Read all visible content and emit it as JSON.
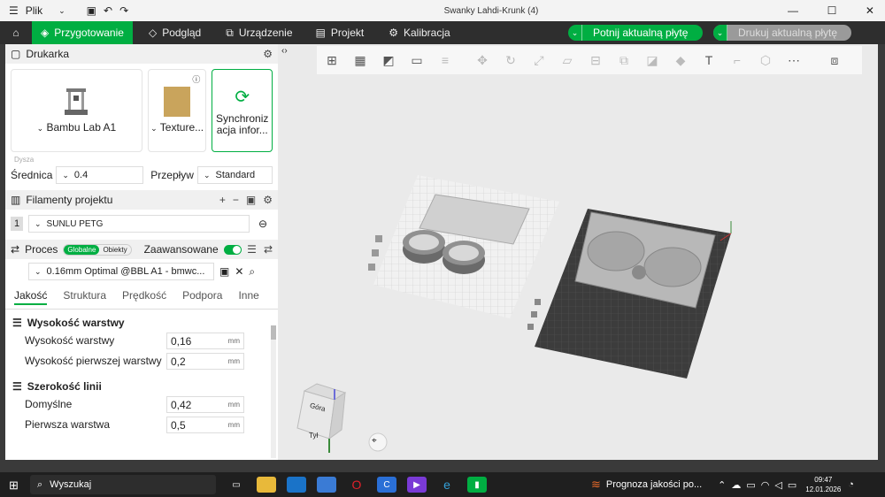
{
  "window": {
    "menu_label": "Plik",
    "title": "Swanky Lahdi-Krunk (4)"
  },
  "tabs": [
    {
      "label": "Przygotowanie"
    },
    {
      "label": "Podgląd"
    },
    {
      "label": "Urządzenie"
    },
    {
      "label": "Projekt"
    },
    {
      "label": "Kalibracja"
    }
  ],
  "actions": {
    "slice": "Potnij aktualną płytę",
    "print": "Drukuj aktualną płytę"
  },
  "printer": {
    "header": "Drukarka",
    "model": "Bambu Lab A1",
    "plate": "Texture...",
    "sync_label_1": "Synchroniz",
    "sync_label_2": "acja infor...",
    "nozzle_section": "Dysza",
    "diameter_label": "Średnica",
    "diameter_value": "0.4",
    "flow_label": "Przepływ",
    "flow_value": "Standard"
  },
  "filaments": {
    "header": "Filamenty projektu",
    "items": [
      {
        "index": "1",
        "name": "SUNLU PETG",
        "color": "#dcdcdc"
      }
    ]
  },
  "process": {
    "header": "Proces",
    "mode_global": "Globalne",
    "mode_objects": "Obiekty",
    "advanced_label": "Zaawansowane",
    "profile": "0.16mm Optimal @BBL A1 - bmwc...",
    "tabs": [
      "Jakość",
      "Struktura",
      "Prędkość",
      "Podpora",
      "Inne"
    ],
    "groups": [
      {
        "title": "Wysokość warstwy",
        "params": [
          {
            "name": "Wysokość warstwy",
            "value": "0,16",
            "unit": "mm"
          },
          {
            "name": "Wysokość pierwszej warstwy",
            "value": "0,2",
            "unit": "mm"
          }
        ]
      },
      {
        "title": "Szerokość linii",
        "params": [
          {
            "name": "Domyślne",
            "value": "0,42",
            "unit": "mm"
          },
          {
            "name": "Pierwsza warstwa",
            "value": "0,5",
            "unit": "mm"
          }
        ]
      }
    ]
  },
  "viewport": {
    "cube_top": "Góra",
    "cube_front": "Tył"
  },
  "taskbar": {
    "search_placeholder": "Wyszukaj",
    "weather": "Prognoza jakości po...",
    "time": "09:47",
    "date": "12.01.2026"
  },
  "colors": {
    "accent": "#00ae42",
    "plate_dark": "#3c3c3c"
  }
}
